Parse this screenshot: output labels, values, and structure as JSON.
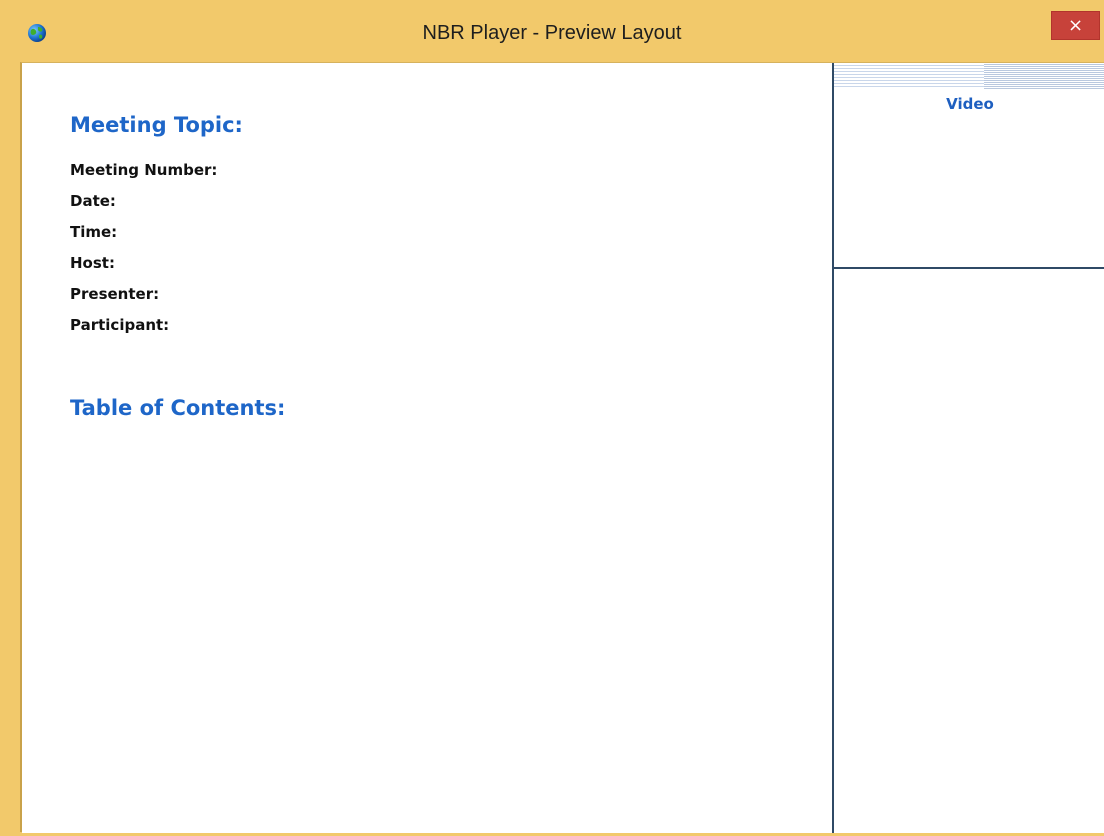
{
  "window": {
    "title": "NBR Player - Preview Layout",
    "close_glyph": "×"
  },
  "icons": {
    "app_icon": "globe-icon",
    "close_icon": "close-icon"
  },
  "colors": {
    "titlebar": "#f2c96b",
    "close_button": "#c7423a",
    "heading_blue": "#1e66c8",
    "divider": "#2f4a66"
  },
  "content": {
    "meeting_topic_label": "Meeting Topic:",
    "fields": {
      "meeting_number": "Meeting Number:",
      "date": "Date:",
      "time": "Time:",
      "host": "Host:",
      "presenter": "Presenter:",
      "participant": "Participant:"
    },
    "toc_label": "Table of Contents:"
  },
  "video_panel": {
    "label": "Video"
  }
}
